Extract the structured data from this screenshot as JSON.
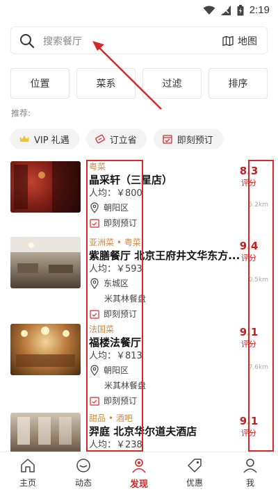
{
  "status_bar": {
    "time": "2:19"
  },
  "search": {
    "placeholder": "搜索餐厅",
    "map_label": "地图"
  },
  "filters": [
    "位置",
    "菜系",
    "过滤",
    "排序"
  ],
  "recommend_label": "推荐:",
  "chips": [
    {
      "label": "VIP 礼遇",
      "icon": "crown-icon"
    },
    {
      "label": "订立省",
      "icon": "coupon-icon"
    },
    {
      "label": "即刻预订",
      "icon": "calendar-check-icon"
    }
  ],
  "restaurants": [
    {
      "cuisine": "粤菜",
      "name": "晶采轩（三星店）",
      "price": "人均：￥800",
      "district": "朝阳区",
      "michelin": "",
      "booking": "即刻预订",
      "score": "8.3",
      "score_label": "评分",
      "distance": "5.2km"
    },
    {
      "cuisine": "亚洲菜 • 粤菜",
      "name": "紫膳餐厅 北京王府井文华东方...",
      "price": "人均：￥593",
      "district": "东城区",
      "michelin": "米其林餐盘",
      "booking": "即刻预订",
      "score": "9.4",
      "score_label": "评分",
      "distance": "0.5km"
    },
    {
      "cuisine": "法国菜",
      "name": "福楼法餐厅",
      "price": "人均：￥813",
      "district": "朝阳区",
      "michelin": "米其林餐盘",
      "booking": "即刻预订",
      "score": "9.1",
      "score_label": "评分",
      "distance": "7.6km"
    },
    {
      "cuisine": "甜品 • 酒吧",
      "name": "羿庭 北京华尔道夫酒店",
      "price": "人均：￥238",
      "district": "",
      "michelin": "",
      "booking": "",
      "score": "9.1",
      "score_label": "评分",
      "distance": ""
    }
  ],
  "tabs": [
    {
      "label": "主页",
      "icon": "home-icon"
    },
    {
      "label": "动态",
      "icon": "feed-icon"
    },
    {
      "label": "发现",
      "icon": "discover-icon",
      "active": true
    },
    {
      "label": "优惠",
      "icon": "tag-icon"
    },
    {
      "label": "我",
      "icon": "profile-icon"
    }
  ],
  "colors": {
    "accent": "#d62828",
    "cuisine": "#c88a44",
    "annotation": "#d62828"
  }
}
